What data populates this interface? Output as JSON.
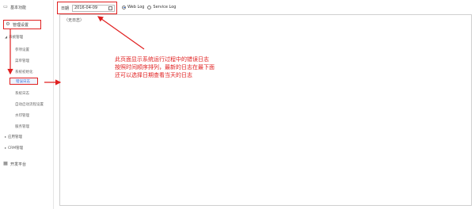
{
  "sidebar": {
    "basic": {
      "icon": "home-icon",
      "label": "基本功能"
    },
    "manage": {
      "icon": "gear-icon",
      "label": "管理设置",
      "system_group": {
        "label": "系统管理",
        "items": [
          "参项设置",
          "菜单管理",
          "系统初始化",
          "错误日志",
          "系统日志",
          "自动启动流程设置",
          "水印管理",
          "服务管理"
        ]
      },
      "groups": [
        "应用管理",
        "CRM管理"
      ]
    },
    "dev": {
      "icon": "grid-icon",
      "label": "开发平台"
    }
  },
  "toolbar": {
    "date_label": "日期",
    "date_value": "2016-04-09",
    "radios": [
      {
        "label": "Web Log",
        "checked": true
      },
      {
        "label": "Service Log",
        "checked": false
      }
    ]
  },
  "log": {
    "empty_text": "（无日志）"
  },
  "annotation": {
    "lines": [
      "此页面显示系统运行过程中的错误日志",
      "按照时间顺序排列，最新的日志在最下面",
      "还可以选择日期查看当天的日志"
    ],
    "color": "#e02020"
  },
  "colors": {
    "highlight": "#e02020",
    "active_text": "#3b6fd4",
    "border": "#cfcfcf"
  }
}
